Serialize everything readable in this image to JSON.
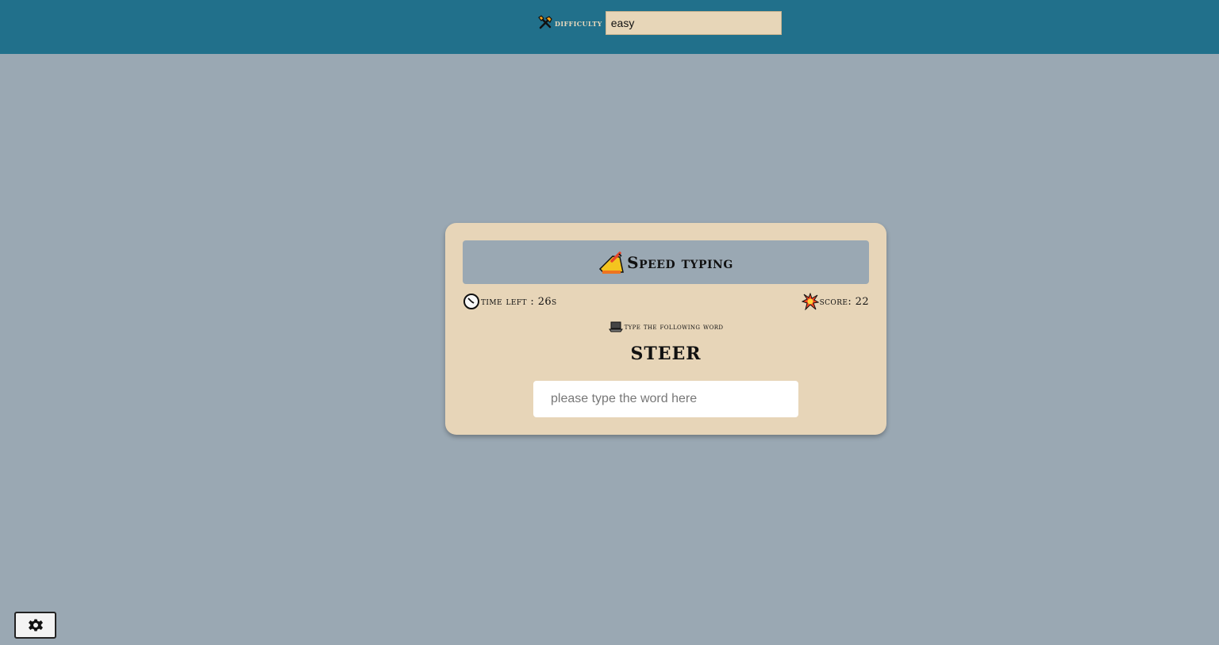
{
  "header": {
    "difficulty_label": "difficulty",
    "difficulty_value": "easy"
  },
  "card": {
    "title": "Speed typing",
    "time_left_text": "time left : 26s",
    "score_text": "score: 22",
    "instruction": "type the following word",
    "word": "STEER",
    "input_placeholder": "please type the word here",
    "input_value": ""
  },
  "icons": {
    "difficulty": "hammer-wrench-icon",
    "title": "writing-hand-icon",
    "timer": "stopwatch-icon",
    "score": "collision-icon",
    "instruction": "laptop-icon",
    "settings": "gear-icon"
  },
  "colors": {
    "topbar": "#21708b",
    "background": "#9aa8b3",
    "card": "#e7d5b8",
    "title_bar": "#9aa8b3"
  }
}
